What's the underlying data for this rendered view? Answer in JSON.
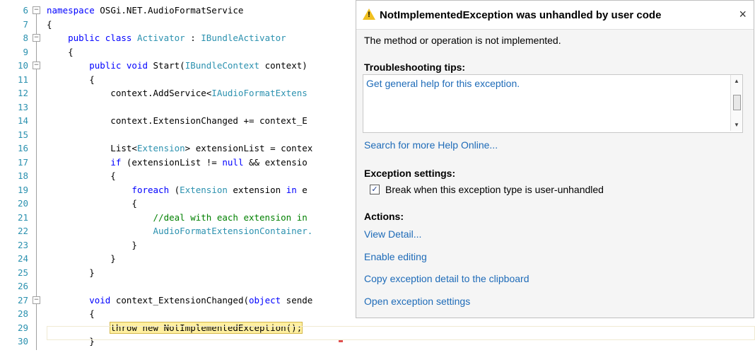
{
  "editor": {
    "lines": [
      {
        "n": "6",
        "parts": [
          {
            "t": "namespace ",
            "c": "kw"
          },
          {
            "t": "OSGi.NET.AudioFormatService",
            "c": ""
          }
        ]
      },
      {
        "n": "7",
        "parts": [
          {
            "t": "{",
            "c": ""
          }
        ]
      },
      {
        "n": "8",
        "parts": [
          {
            "t": "    ",
            "c": ""
          },
          {
            "t": "public class ",
            "c": "kw"
          },
          {
            "t": "Activator",
            "c": "ty"
          },
          {
            "t": " : ",
            "c": ""
          },
          {
            "t": "IBundleActivator",
            "c": "ty"
          }
        ]
      },
      {
        "n": "9",
        "parts": [
          {
            "t": "    {",
            "c": ""
          }
        ]
      },
      {
        "n": "10",
        "parts": [
          {
            "t": "        ",
            "c": ""
          },
          {
            "t": "public void ",
            "c": "kw"
          },
          {
            "t": "Start(",
            "c": ""
          },
          {
            "t": "IBundleContext",
            "c": "ty"
          },
          {
            "t": " context)",
            "c": ""
          }
        ]
      },
      {
        "n": "11",
        "parts": [
          {
            "t": "        {",
            "c": ""
          }
        ]
      },
      {
        "n": "12",
        "parts": [
          {
            "t": "            context.AddService<",
            "c": ""
          },
          {
            "t": "IAudioFormatExtens",
            "c": "ty"
          }
        ]
      },
      {
        "n": "13",
        "parts": []
      },
      {
        "n": "14",
        "parts": [
          {
            "t": "            context.ExtensionChanged += context_E",
            "c": ""
          }
        ]
      },
      {
        "n": "15",
        "parts": []
      },
      {
        "n": "16",
        "parts": [
          {
            "t": "            List<",
            "c": ""
          },
          {
            "t": "Extension",
            "c": "ty"
          },
          {
            "t": "> extensionList = contex",
            "c": ""
          }
        ]
      },
      {
        "n": "17",
        "parts": [
          {
            "t": "            ",
            "c": ""
          },
          {
            "t": "if",
            "c": "kw"
          },
          {
            "t": " (extensionList != ",
            "c": ""
          },
          {
            "t": "null",
            "c": "kw"
          },
          {
            "t": " && extensio",
            "c": ""
          }
        ]
      },
      {
        "n": "18",
        "parts": [
          {
            "t": "            {",
            "c": ""
          }
        ]
      },
      {
        "n": "19",
        "parts": [
          {
            "t": "                ",
            "c": ""
          },
          {
            "t": "foreach",
            "c": "kw"
          },
          {
            "t": " (",
            "c": ""
          },
          {
            "t": "Extension",
            "c": "ty"
          },
          {
            "t": " extension ",
            "c": ""
          },
          {
            "t": "in",
            "c": "kw"
          },
          {
            "t": " e",
            "c": ""
          }
        ]
      },
      {
        "n": "20",
        "parts": [
          {
            "t": "                {",
            "c": ""
          }
        ]
      },
      {
        "n": "21",
        "parts": [
          {
            "t": "                    ",
            "c": ""
          },
          {
            "t": "//deal with each extension in",
            "c": "cm"
          }
        ]
      },
      {
        "n": "22",
        "parts": [
          {
            "t": "                    ",
            "c": ""
          },
          {
            "t": "AudioFormatExtensionContainer.",
            "c": "ty"
          }
        ]
      },
      {
        "n": "23",
        "parts": [
          {
            "t": "                }",
            "c": ""
          }
        ]
      },
      {
        "n": "24",
        "parts": [
          {
            "t": "            }",
            "c": ""
          }
        ]
      },
      {
        "n": "25",
        "parts": [
          {
            "t": "        }",
            "c": ""
          }
        ]
      },
      {
        "n": "26",
        "parts": []
      },
      {
        "n": "27",
        "parts": [
          {
            "t": "        ",
            "c": ""
          },
          {
            "t": "void",
            "c": "kw"
          },
          {
            "t": " context_ExtensionChanged(",
            "c": ""
          },
          {
            "t": "object",
            "c": "kw"
          },
          {
            "t": " sende",
            "c": ""
          }
        ]
      },
      {
        "n": "28",
        "parts": [
          {
            "t": "        {",
            "c": ""
          }
        ]
      },
      {
        "n": "29",
        "parts": [
          {
            "t": "            ",
            "c": ""
          },
          {
            "t": "throw new NotImplementedException();",
            "c": "hl"
          }
        ]
      },
      {
        "n": "30",
        "parts": [
          {
            "t": "        }",
            "c": ""
          }
        ]
      }
    ]
  },
  "popup": {
    "title": "NotImplementedException was unhandled by user code",
    "close": "×",
    "message": "The method or operation is not implemented.",
    "tips_header": "Troubleshooting tips:",
    "tip_link": "Get general help for this exception.",
    "search_link": "Search for more Help Online...",
    "settings_header": "Exception settings:",
    "checkbox_label": "Break when this exception type is user-unhandled",
    "actions_header": "Actions:",
    "actions": [
      "View Detail...",
      "Enable editing",
      "Copy exception detail to the clipboard",
      "Open exception settings"
    ]
  },
  "colors": {
    "accent": "#1e6bb8",
    "highlight": "#ffef9f",
    "warning": "#f0c020"
  },
  "icons": {
    "warning": "warning-icon",
    "close": "close-icon",
    "check": "check-icon"
  }
}
